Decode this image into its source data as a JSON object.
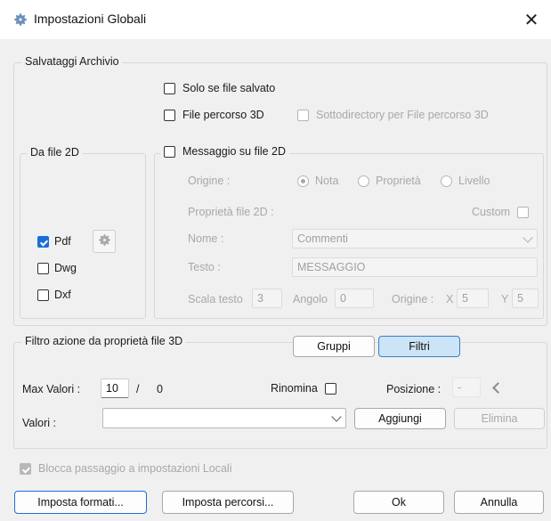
{
  "window": {
    "title": "Impostazioni Globali",
    "close_glyph": "✕"
  },
  "archive_group": {
    "legend": "Salvataggi Archivio",
    "solo_salvato": "Solo se file salvato",
    "file_percorso_3d": "File percorso 3D",
    "sottodirectory": "Sottodirectory per File percorso 3D"
  },
  "da_file_2d": {
    "legend": "Da file 2D",
    "pdf": "Pdf",
    "dwg": "Dwg",
    "dxf": "Dxf"
  },
  "messaggio": {
    "label": "Messaggio su file 2D",
    "origine_label": "Origine :",
    "origine_options": [
      "Nota",
      "Proprietà",
      "Livello"
    ],
    "proprieta_label": "Proprietà file 2D :",
    "custom_label": "Custom",
    "nome_label": "Nome :",
    "nome_value": "Commenti",
    "testo_label": "Testo :",
    "testo_value": "MESSAGGIO",
    "scala_label": "Scala testo",
    "scala_value": "3",
    "angolo_label": "Angolo",
    "angolo_value": "0",
    "origine2_label": "Origine :",
    "x_label": "X",
    "x_value": "5",
    "y_label": "Y",
    "y_value": "5"
  },
  "filtro": {
    "legend": "Filtro azione da proprietà file 3D",
    "gruppi_label": "Gruppi",
    "filtri_label": "Filtri",
    "max_label": "Max Valori :",
    "max_value": "10",
    "slash": "/",
    "count": "0",
    "rinomina_label": "Rinomina",
    "posizione_label": "Posizione :",
    "posizione_value": "-",
    "valori_label": "Valori :",
    "valori_value": "",
    "aggiungi_label": "Aggiungi",
    "elimina_label": "Elimina"
  },
  "blocca_label": "Blocca passaggio a impostazioni Locali",
  "footer": {
    "imposta_formati": "Imposta formati...",
    "imposta_percorsi": "Imposta percorsi...",
    "ok": "Ok",
    "annulla": "Annulla"
  },
  "colors": {
    "accent": "#1a6fd6",
    "toggled": "#cce4f7"
  },
  "icons": {
    "title": "gear-icon",
    "pdf_settings": "gear-icon",
    "back": "chevron-left-icon"
  }
}
